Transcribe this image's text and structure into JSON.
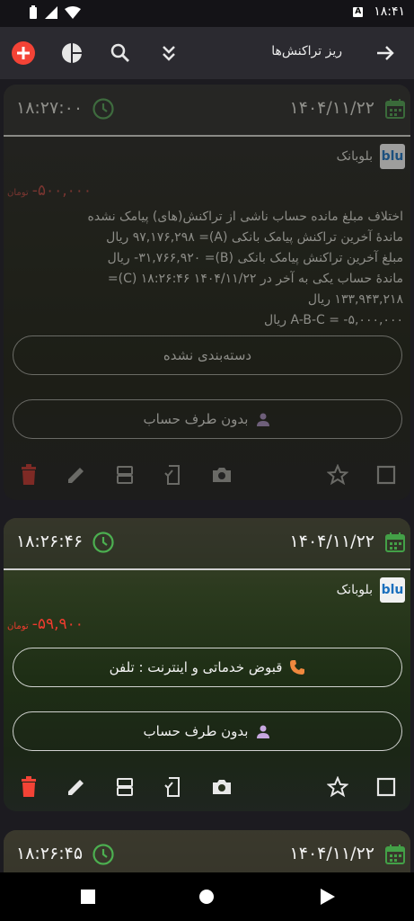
{
  "status_bar": {
    "time": "۱۸:۴۱",
    "badge": "A"
  },
  "app_bar": {
    "title": "ریز تراکنش‌ها"
  },
  "transactions": [
    {
      "time": "۱۸:۲۷:۰۰",
      "date": "۱۴۰۴/۱۱/۲۲",
      "bank_logo": "blu",
      "bank_name": "بلوبانک",
      "amount": "-۵۰۰,۰۰۰",
      "currency": "تومان",
      "description": [
        "اختلاف مبلغ مانده حساب ناشی از تراکنش(های) پیامک نشده",
        "ماندهٔ آخرین تراکنش پیامک بانکی (A)= ۹۷,۱۷۶,۲۹۸ ریال",
        "مبلغ آخرین تراکنش پیامک بانکی (B)= ۳۱,۷۶۶,۹۲۰- ریال",
        "ماندهٔ حساب یکی به آخر در ۱۴۰۴/۱۱/۲۲ ۱۸:۲۶:۴۶ (C)=",
        "۱۳۳,۹۴۳,۲۱۸ ریال",
        "A-B-C = -۵,۰۰۰,۰۰۰ ریال"
      ],
      "category": "دسته‌بندی نشده",
      "counterparty": "بدون طرف حساب"
    },
    {
      "time": "۱۸:۲۶:۴۶",
      "date": "۱۴۰۴/۱۱/۲۲",
      "bank_logo": "blu",
      "bank_name": "بلوبانک",
      "amount": "-۵۹,۹۰۰",
      "currency": "تومان",
      "category": "قبوض خدماتی و اینترنت : تلفن",
      "counterparty": "بدون طرف حساب"
    },
    {
      "time": "۱۸:۲۶:۴۵",
      "date": "۱۴۰۴/۱۱/۲۲"
    }
  ],
  "colors": {
    "accent_red": "#f44336",
    "amount_red": "#ef3b2e",
    "clock_green": "#4caf50",
    "calendar_green": "#43a047",
    "background": "#1c1b20",
    "appbar": "#2b2a30"
  },
  "icons": {
    "appbar": [
      "add-icon",
      "pie-chart-icon",
      "search-icon",
      "expand-all-icon",
      "back-arrow-icon"
    ],
    "card_actions": [
      "delete-icon",
      "edit-icon",
      "split-icon",
      "attach-receipt-icon",
      "camera-icon",
      "star-icon",
      "checkbox-icon"
    ],
    "nav": [
      "recents-icon",
      "home-icon",
      "back-icon"
    ]
  }
}
